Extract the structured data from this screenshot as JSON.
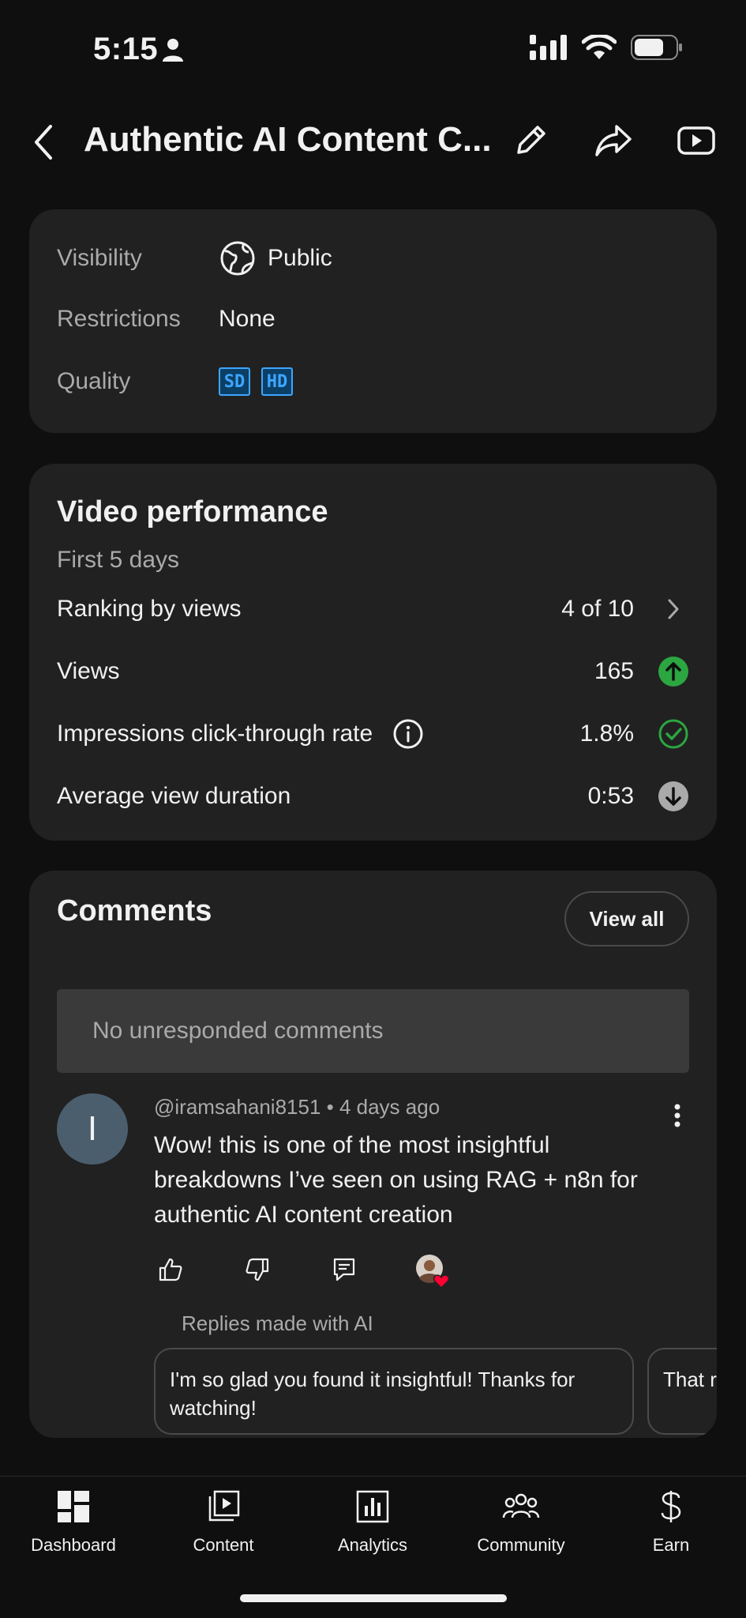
{
  "status_bar": {
    "time": "5:15"
  },
  "header": {
    "title": "Authentic AI Content C..."
  },
  "info": {
    "visibility_label": "Visibility",
    "visibility_value": "Public",
    "restrictions_label": "Restrictions",
    "restrictions_value": "None",
    "quality_label": "Quality",
    "quality_badges": [
      "SD",
      "HD"
    ]
  },
  "performance": {
    "title": "Video performance",
    "subtitle": "First 5 days",
    "rows": [
      {
        "label": "Ranking by views",
        "value": "4 of 10",
        "icon": "chevron-right-icon"
      },
      {
        "label": "Views",
        "value": "165",
        "icon": "arrow-up-circle-icon"
      },
      {
        "label": "Impressions click-through rate",
        "value": "1.8%",
        "icon": "check-circle-icon"
      },
      {
        "label": "Average view duration",
        "value": "0:53",
        "icon": "arrow-down-circle-icon"
      }
    ]
  },
  "comments": {
    "title": "Comments",
    "view_all": "View all",
    "unresponded": "No unresponded comments",
    "comment": {
      "avatar_letter": "I",
      "meta": "@iramsahani8151 • 4 days ago",
      "text": "Wow! this is one of the most insightful breakdowns I’ve seen on using RAG + n8n for authentic AI content creation"
    },
    "ai_replies_label": "Replies made with AI",
    "ai_replies": [
      "I'm so glad you found it insightful! Thanks for watching!",
      "That r you 🙏"
    ]
  },
  "bottom_nav": [
    {
      "label": "Dashboard"
    },
    {
      "label": "Content"
    },
    {
      "label": "Analytics"
    },
    {
      "label": "Community"
    },
    {
      "label": "Earn"
    }
  ],
  "colors": {
    "background": "#0f0f0f",
    "card": "#212121",
    "accent_green": "#2ba640",
    "quality_blue": "#3ea6ff",
    "heart_red": "#ff0033"
  }
}
